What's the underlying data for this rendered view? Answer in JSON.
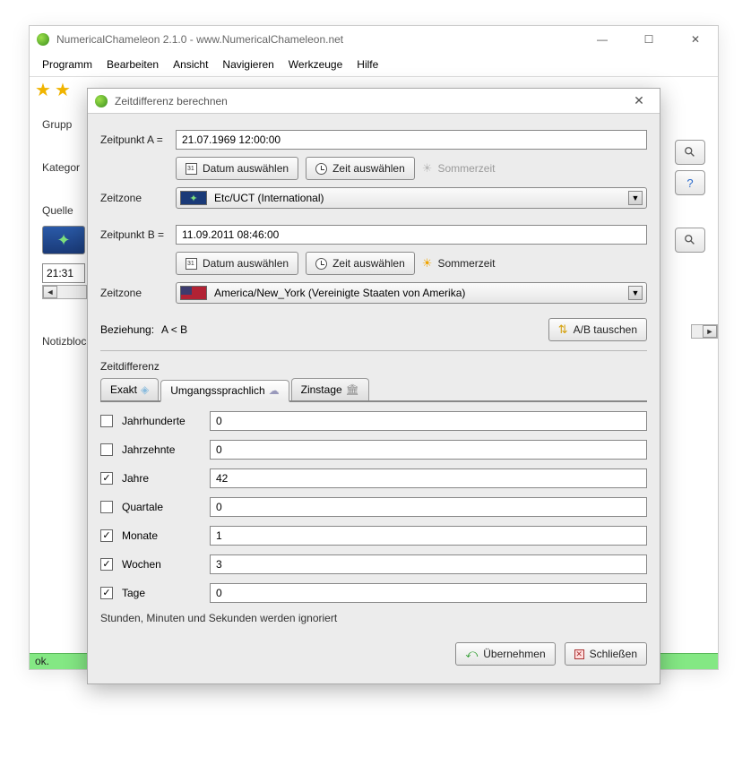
{
  "main": {
    "title": "NumericalChameleon 2.1.0 - www.NumericalChameleon.net",
    "menu": [
      "Programm",
      "Bearbeiten",
      "Ansicht",
      "Navigieren",
      "Werkzeuge",
      "Hilfe"
    ],
    "labels": {
      "gruppe": "Grupp",
      "kategorie": "Kategor",
      "quelle": "Quelle",
      "notizblock": "Notizbloc"
    },
    "time_value": "21:31",
    "status": "ok."
  },
  "dialog": {
    "title": "Zeitdifferenz berechnen",
    "pointA": {
      "label": "Zeitpunkt A =",
      "value": "21.07.1969 12:00:00"
    },
    "pointB": {
      "label": "Zeitpunkt B =",
      "value": "11.09.2011 08:46:00"
    },
    "buttons": {
      "date": "Datum auswählen",
      "time": "Zeit auswählen",
      "dst": "Sommerzeit",
      "swap": "A/B tauschen",
      "apply": "Übernehmen",
      "close": "Schließen"
    },
    "timezone_label": "Zeitzone",
    "tzA": "Etc/UCT (International)",
    "tzB": "America/New_York (Vereinigte Staaten von Amerika)",
    "relation": {
      "label": "Beziehung:",
      "value": "A < B"
    },
    "section": "Zeitdifferenz",
    "tabs": [
      "Exakt",
      "Umgangssprachlich",
      "Zinstage"
    ],
    "results": [
      {
        "label": "Jahrhunderte",
        "checked": false,
        "value": "0"
      },
      {
        "label": "Jahrzehnte",
        "checked": false,
        "value": "0"
      },
      {
        "label": "Jahre",
        "checked": true,
        "value": "42"
      },
      {
        "label": "Quartale",
        "checked": false,
        "value": "0"
      },
      {
        "label": "Monate",
        "checked": true,
        "value": "1"
      },
      {
        "label": "Wochen",
        "checked": true,
        "value": "3"
      },
      {
        "label": "Tage",
        "checked": true,
        "value": "0"
      }
    ],
    "note": "Stunden, Minuten und Sekunden werden ignoriert"
  }
}
